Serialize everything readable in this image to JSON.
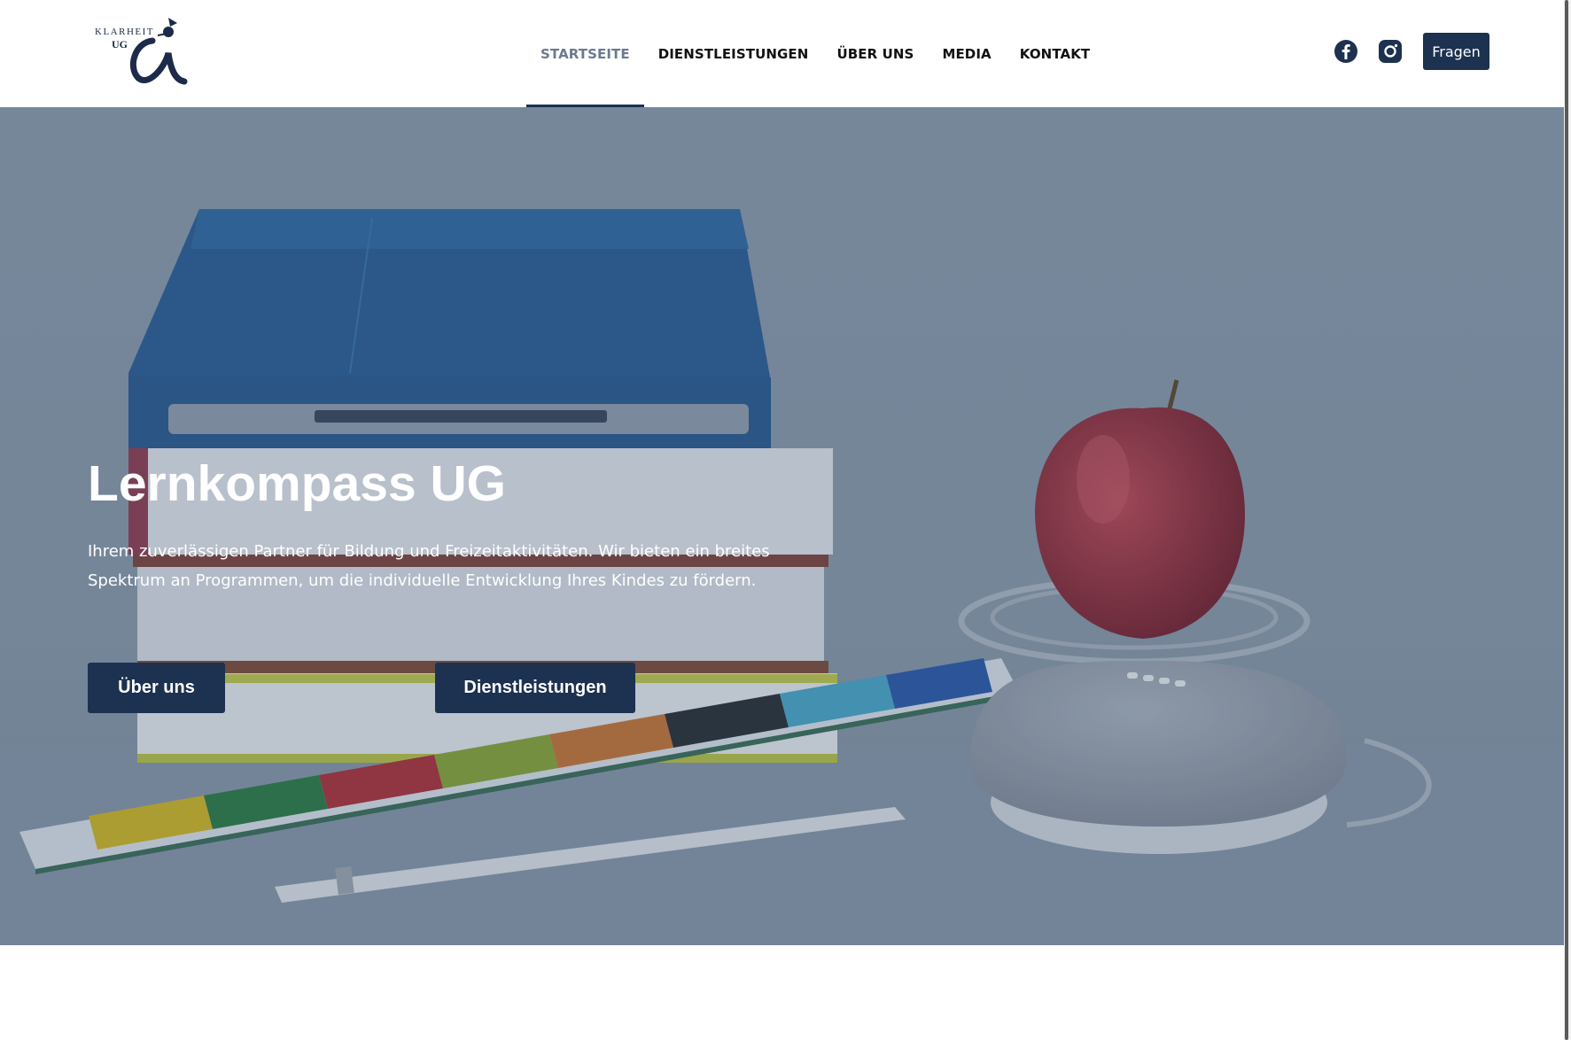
{
  "brand": {
    "logo_line1": "KLARHEIT",
    "logo_line2": "UG",
    "colors": {
      "primary": "#1d3150",
      "nav_active": "#6b7a8f"
    }
  },
  "nav": {
    "items": [
      {
        "label": "STARTSEITE",
        "active": true
      },
      {
        "label": "DIENSTLEISTUNGEN",
        "active": false
      },
      {
        "label": "ÜBER UNS",
        "active": false
      },
      {
        "label": "MEDIA",
        "active": false
      },
      {
        "label": "KONTAKT",
        "active": false
      }
    ]
  },
  "header": {
    "social_icons": [
      "facebook-icon",
      "instagram-icon"
    ],
    "ask_button_label": "Fragen"
  },
  "hero": {
    "title": "Lernkompass UG",
    "text": "Ihrem zuverlässigen Partner für Bildung und Freizeitaktivitäten. Wir bieten ein breites Spektrum an Programmen, um die individuelle Entwicklung Ihres Kindes zu fördern.",
    "buttons": {
      "about_label": "Über uns",
      "services_label": "Dienstleistungen"
    }
  }
}
